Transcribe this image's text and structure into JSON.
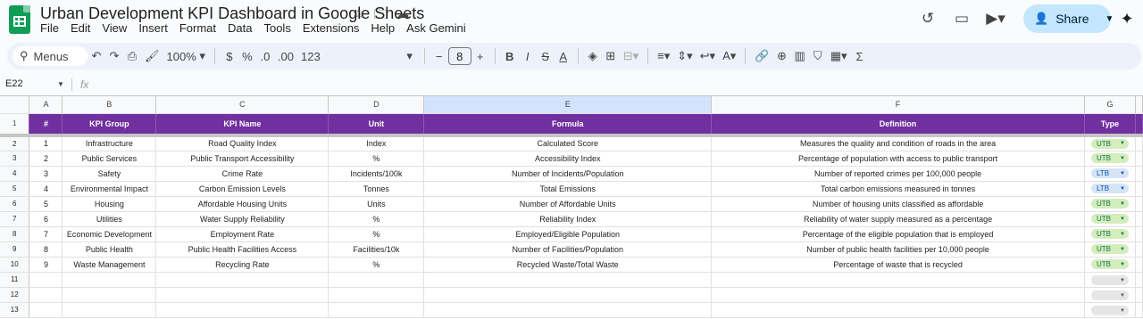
{
  "app": {
    "title": "Urban Development KPI Dashboard in Google Sheets",
    "menu": [
      "File",
      "Edit",
      "View",
      "Insert",
      "Format",
      "Data",
      "Tools",
      "Extensions",
      "Help",
      "Ask Gemini"
    ],
    "share_label": "Share"
  },
  "toolbar": {
    "menus_label": "Menus",
    "zoom": "100%",
    "currency": "$",
    "percent": "%",
    "dec_less": ".0",
    "dec_more": ".00",
    "number_format": "123",
    "font_size": "8",
    "bold": "B"
  },
  "formula_bar": {
    "cell_ref": "E22",
    "fx": "fx",
    "content": ""
  },
  "columns": [
    "A",
    "B",
    "C",
    "D",
    "E",
    "F",
    "G"
  ],
  "selected_column": "E",
  "header": [
    "#",
    "KPI Group",
    "KPI Name",
    "Unit",
    "Formula",
    "Definition",
    "Type"
  ],
  "rows": [
    {
      "n": "1",
      "group": "Infrastructure",
      "name": "Road Quality Index",
      "unit": "Index",
      "formula": "Calculated Score",
      "definition": "Measures the quality and condition of roads in the area",
      "type": "UTB"
    },
    {
      "n": "2",
      "group": "Public Services",
      "name": "Public Transport Accessibility",
      "unit": "%",
      "formula": "Accessibility Index",
      "definition": "Percentage of population with access to public transport",
      "type": "UTB"
    },
    {
      "n": "3",
      "group": "Safety",
      "name": "Crime Rate",
      "unit": "Incidents/100k",
      "formula": "Number of Incidents/Population",
      "definition": "Number of reported crimes per 100,000 people",
      "type": "LTB"
    },
    {
      "n": "4",
      "group": "Environmental Impact",
      "name": "Carbon Emission Levels",
      "unit": "Tonnes",
      "formula": "Total Emissions",
      "definition": "Total carbon emissions measured in tonnes",
      "type": "LTB"
    },
    {
      "n": "5",
      "group": "Housing",
      "name": "Affordable Housing Units",
      "unit": "Units",
      "formula": "Number of Affordable Units",
      "definition": "Number of housing units classified as affordable",
      "type": "UTB"
    },
    {
      "n": "6",
      "group": "Utilities",
      "name": "Water Supply Reliability",
      "unit": "%",
      "formula": "Reliability Index",
      "definition": "Reliability of water supply measured as a percentage",
      "type": "UTB"
    },
    {
      "n": "7",
      "group": "Economic Development",
      "name": "Employment Rate",
      "unit": "%",
      "formula": "Employed/Eligible Population",
      "definition": "Percentage of the eligible population that is employed",
      "type": "UTB"
    },
    {
      "n": "8",
      "group": "Public Health",
      "name": "Public Health Facilities Access",
      "unit": "Facilities/10k",
      "formula": "Number of Facilities/Population",
      "definition": "Number of public health facilities per 10,000 people",
      "type": "UTB"
    },
    {
      "n": "9",
      "group": "Waste Management",
      "name": "Recycling Rate",
      "unit": "%",
      "formula": "Recycled Waste/Total Waste",
      "definition": "Percentage of waste that is recycled",
      "type": "UTB"
    }
  ],
  "row_numbers": [
    "1",
    "2",
    "3",
    "4",
    "5",
    "6",
    "7",
    "8",
    "9",
    "10",
    "11",
    "12",
    "13"
  ],
  "empty_rows": [
    "11",
    "12",
    "13"
  ],
  "colors": {
    "header_bg": "#7030a0",
    "utb_bg": "#d4edbc",
    "ltb_bg": "#d6e4f7"
  }
}
